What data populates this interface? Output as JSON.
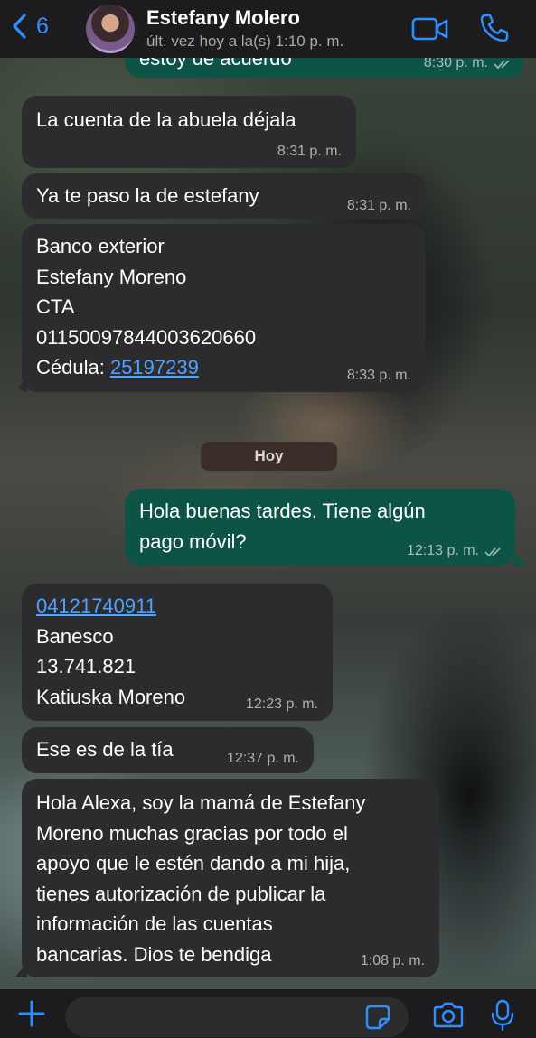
{
  "header": {
    "back_count": "6",
    "contact_name": "Estefany Molero",
    "status": "últ. vez hoy a la(s) 1:10 p. m."
  },
  "chat": {
    "top_partial": {
      "text": "estoy de acuerdo",
      "time": "8:30 p. m."
    },
    "messages": [
      {
        "lines": [
          "La cuenta de la abuela déjala"
        ],
        "time": "8:31 p. m."
      },
      {
        "lines": [
          "Ya te paso la de estefany"
        ],
        "time": "8:31 p. m."
      },
      {
        "lines": [
          "Banco exterior",
          "Estefany Moreno",
          "CTA",
          "01150097844003620660"
        ],
        "cedula_label": "Cédula: ",
        "cedula_link": "25197239",
        "time": "8:33 p. m."
      },
      {
        "lines": [
          "Hola buenas tardes. Tiene algún",
          "pago móvil?"
        ],
        "time": "12:13 p. m."
      },
      {
        "phone_link": "04121740911",
        "lines": [
          "Banesco",
          "13.741.821",
          "Katiuska Moreno"
        ],
        "time": "12:23 p. m."
      },
      {
        "lines": [
          "Ese es de la tía"
        ],
        "time": "12:37 p. m."
      },
      {
        "lines": [
          "Hola Alexa, soy la mamá de Estefany",
          "Moreno muchas gracias por todo el",
          "apoyo que le estén dando a mi hija,",
          "tienes autorización de publicar la",
          "información de las cuentas",
          "bancarias. Dios te bendiga"
        ],
        "time": "1:08 p. m."
      }
    ],
    "day_separator": "Hoy"
  },
  "composer": {
    "placeholder": ""
  },
  "colors": {
    "accent": "#2f8fff",
    "incoming_bubble": "#2c2c2e",
    "outgoing_bubble": "#0d5446",
    "link": "#4da3ff"
  }
}
